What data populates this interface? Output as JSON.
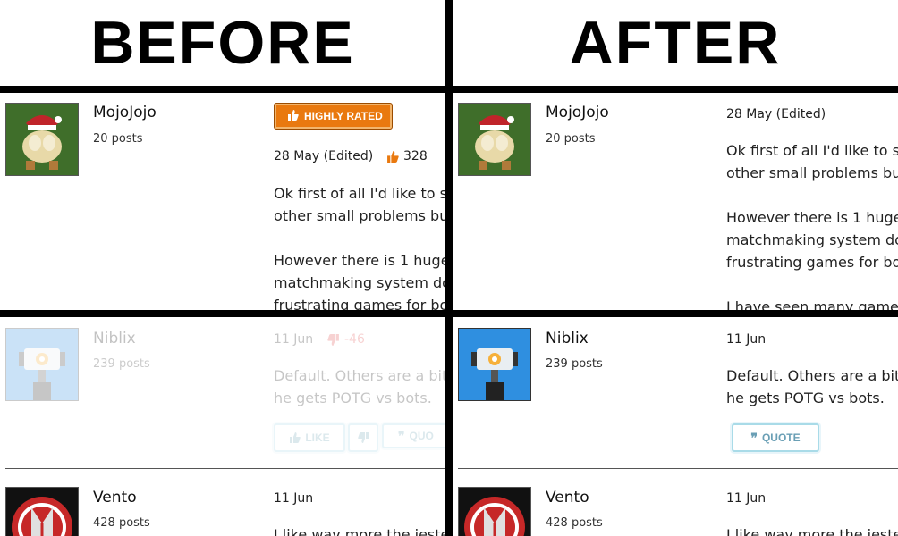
{
  "headings": {
    "before": "BEFORE",
    "after": "AFTER"
  },
  "post1": {
    "username": "MojoJojo",
    "posts": "20 posts",
    "badge": "HIGHLY RATED",
    "date": "28 May (Edited)",
    "votes": "328",
    "before_lines": [
      "Ok first of all I'd like to s",
      "other small problems bu",
      "",
      "However there is 1 huge",
      "matchmaking system do",
      "frustrating games for bo"
    ],
    "after_lines": [
      "Ok first of all I'd like to s",
      "other small problems bu",
      "",
      "However there is 1 huge",
      "matchmaking system do",
      "frustrating games for bo",
      "",
      "I have seen many games"
    ]
  },
  "post2": {
    "username": "Niblix",
    "posts": "239 posts",
    "date": "11 Jun",
    "votes": "-46",
    "lines": [
      "Default. Others are a bit",
      "he gets POTG vs bots."
    ],
    "like_label": "LIKE",
    "quote_label": "QUOTE",
    "before_quote_label": "QUO"
  },
  "post3": {
    "username": "Vento",
    "posts": "428 posts",
    "date": "11 Jun",
    "line": "I like way more the jeste"
  },
  "colors": {
    "accent": "#e9790f",
    "button_border": "#a9dbe8",
    "downvote": "#e05050"
  }
}
